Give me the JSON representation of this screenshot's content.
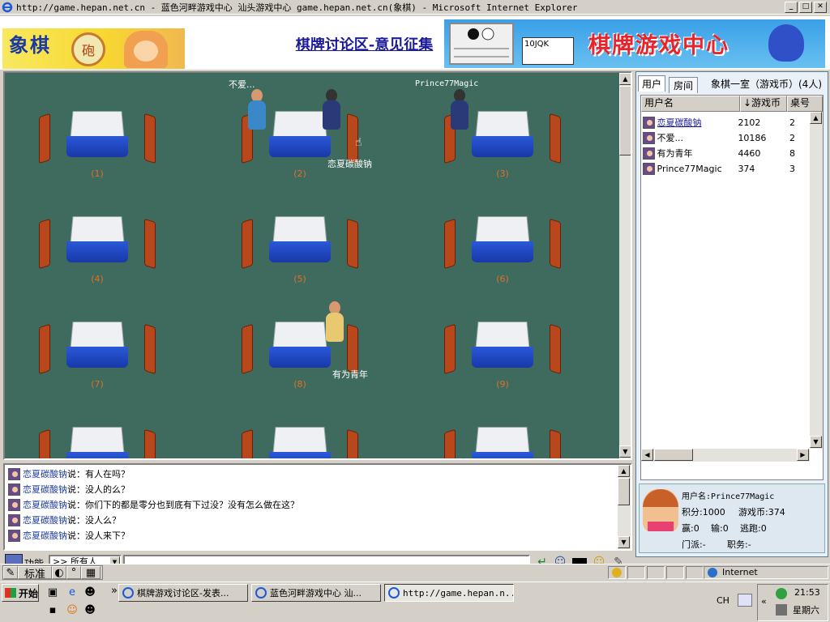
{
  "window": {
    "title": "http://game.hepan.net.cn - 蓝色河畔游戏中心 汕头游戏中心 game.hepan.net.cn(象棋) - Microsoft Internet Explorer",
    "min_btn": "_",
    "max_btn": "□",
    "close_btn": "✕"
  },
  "banner": {
    "logo_text": "象棋",
    "logo_stamp": "砲",
    "forum_link": "棋牌讨论区-意见征集",
    "ad_text": "棋牌游戏中心",
    "ad_cards": "10JQK"
  },
  "room": {
    "tables": [
      {
        "label": "(1)"
      },
      {
        "label": "(2)"
      },
      {
        "label": "(3)"
      },
      {
        "label": "(4)"
      },
      {
        "label": "(5)"
      },
      {
        "label": "(6)"
      },
      {
        "label": "(7)"
      },
      {
        "label": "(8)"
      },
      {
        "label": "(9)"
      }
    ],
    "player_names": {
      "t2_top": "不爱...",
      "t2_bottom": "恋夏碳酸钠",
      "t3_top": "Prince77Magic",
      "t8_bottom": "有为青年"
    }
  },
  "chat": {
    "lines": [
      {
        "name": "恋夏碳酸钠",
        "text": "说：有人在吗？"
      },
      {
        "name": "恋夏碳酸钠",
        "text": "说：没人的么？"
      },
      {
        "name": "恋夏碳酸钠",
        "text": "说：你们下的都是零分也到底有下过没？没有怎么做在这？"
      },
      {
        "name": "恋夏碳酸钠",
        "text": "说：没人么？"
      },
      {
        "name": "恋夏碳酸钠",
        "text": "说：没人来下？"
      }
    ]
  },
  "input": {
    "func_label": "功能",
    "target": ">> 所有人",
    "message": ""
  },
  "panel": {
    "tab_users": "用户",
    "tab_rooms": "房间",
    "room_label": "象棋一室（游戏币）(4人)",
    "col_name": "用户名",
    "col_coins": "↓游戏币",
    "col_table": "桌号",
    "users": [
      {
        "name": "恋夏碳酸钠",
        "coins": "2102",
        "table": "2"
      },
      {
        "name": "不爱...",
        "coins": "10186",
        "table": "2"
      },
      {
        "name": "有为青年",
        "coins": "4460",
        "table": "8"
      },
      {
        "name": "Prince77Magic",
        "coins": "374",
        "table": "3"
      }
    ],
    "profile": {
      "username": "用户名:Prince77Magic",
      "score": "积分:1000",
      "coins": "游戏币:374",
      "wins": "赢:0",
      "losses": "输:0",
      "escapes": "逃跑:0",
      "faction": "门派:-",
      "role": "职务:-"
    }
  },
  "statusbar": {
    "zone": "Internet",
    "ime_mode": "标准"
  },
  "taskbar": {
    "start": "开始",
    "chevron": "»",
    "tasks": [
      "棋牌游戏讨论区-发表...",
      "蓝色河畔游戏中心 汕...",
      "http://game.hepan.n..."
    ],
    "lang": "CH",
    "time": "21:53",
    "weekday": "星期六"
  },
  "colors": {
    "room_bg": "#3e6b5e",
    "table_number": "#e0702a",
    "chat_name": "#1a3aa0",
    "forum_link": "#1a1a9a"
  }
}
